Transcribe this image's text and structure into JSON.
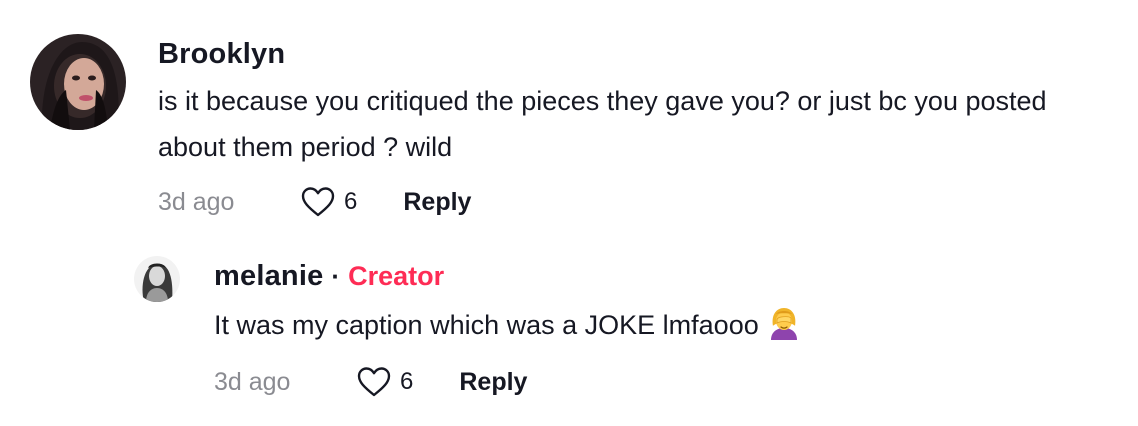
{
  "comments": {
    "top": {
      "username": "Brooklyn",
      "text": "is it because you critiqued the pieces they gave you? or just bc you posted about them period ? wild",
      "time": "3d ago",
      "likes": "6",
      "reply_label": "Reply",
      "avatar_icon": "user-avatar-photo"
    },
    "reply": {
      "username": "melanie",
      "separator": "·",
      "badge": "Creator",
      "text": "It was my caption which was a JOKE lmfaooo",
      "emoji": "woman-facepalming-emoji",
      "time": "3d ago",
      "likes": "6",
      "reply_label": "Reply",
      "avatar_icon": "user-avatar-photo"
    }
  },
  "colors": {
    "creator_badge": "#fe2c55",
    "meta_gray": "#8a8b91",
    "text": "#161823"
  }
}
